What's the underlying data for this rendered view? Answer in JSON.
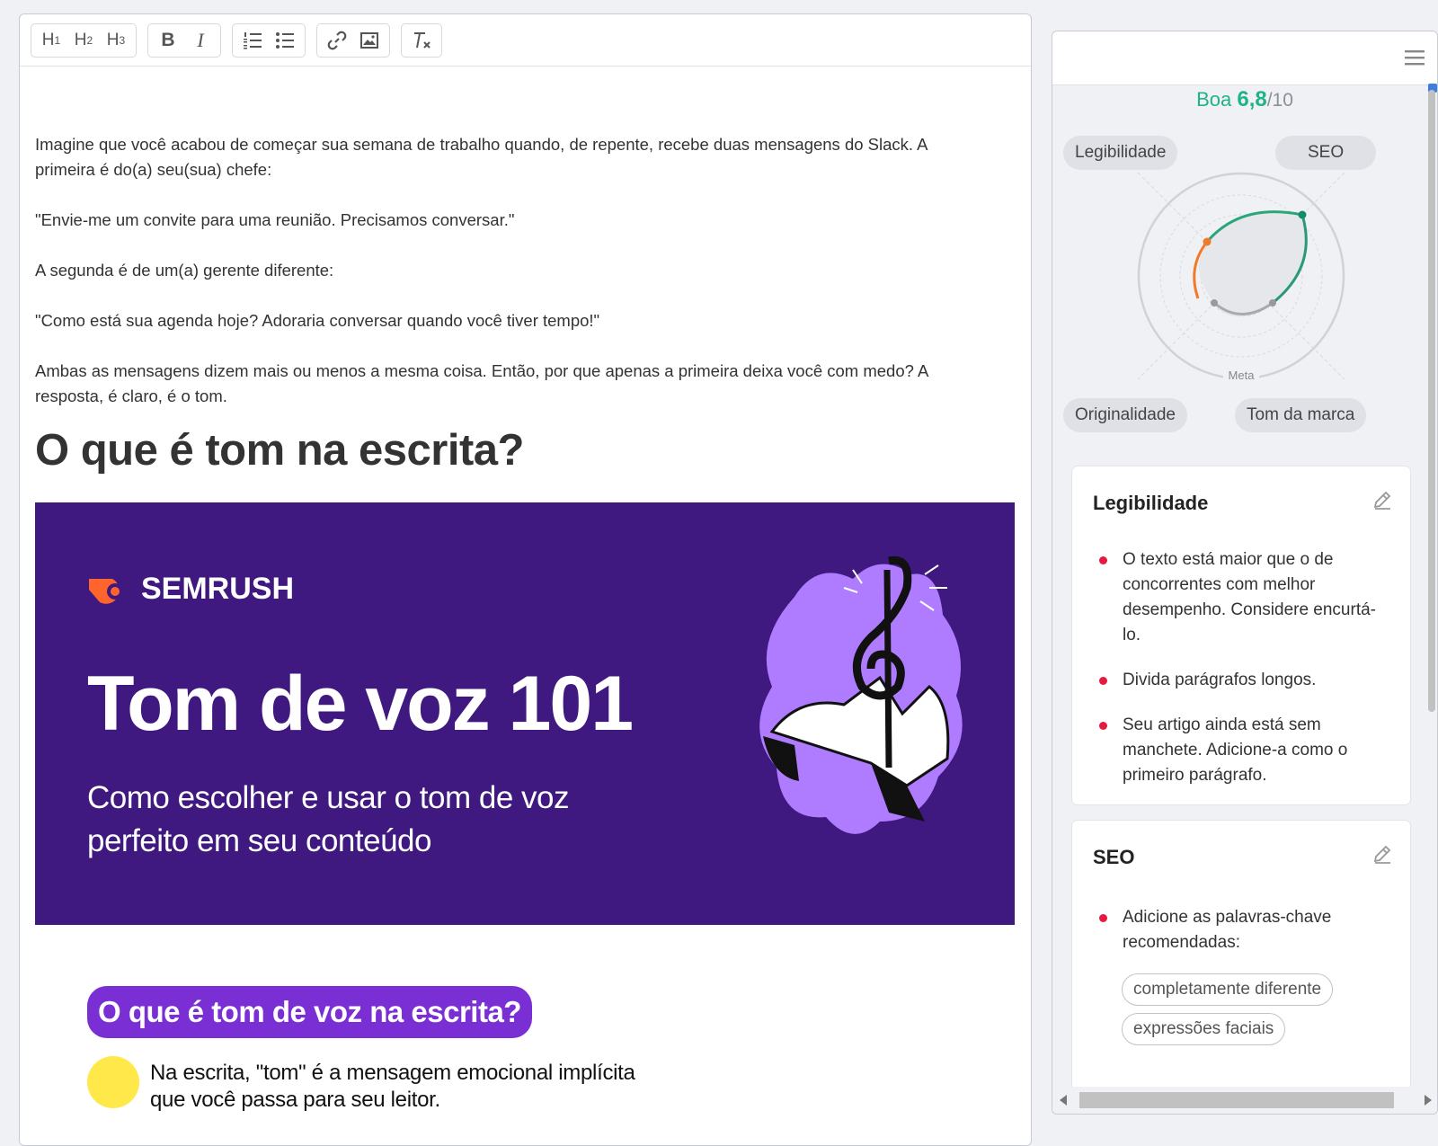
{
  "toolbar": {
    "h1": "H",
    "h1_sub": "1",
    "h2": "H",
    "h2_sub": "2",
    "h3": "H",
    "h3_sub": "3",
    "bold": "B",
    "italic": "I"
  },
  "article": {
    "paragraphs": [
      "Imagine que você acabou de começar sua semana de trabalho quando, de repente, recebe duas mensagens do Slack. A primeira é do(a) seu(sua) chefe:",
      "\"Envie-me um convite para uma reunião. Precisamos conversar.\"",
      "A segunda é de um(a) gerente diferente:",
      "\"Como está sua agenda hoje? Adoraria conversar quando você tiver tempo!\"",
      "Ambas as mensagens dizem mais ou menos a mesma coisa. Então, por que apenas a primeira deixa você com medo? A resposta, é claro, é o tom."
    ],
    "heading": "O que é tom na escrita?",
    "banner": {
      "brand": "SEMRUSH",
      "title": "Tom de voz 101",
      "subtitle": "Como escolher e usar o tom de voz perfeito em seu conteúdo",
      "bg_color": "#3f197f",
      "art_color": "#b07cff"
    },
    "pill_heading": "O que é tom de voz na escrita?",
    "tip_text": "Na escrita, \"tom\" é a mensagem emocional implícita que você passa para seu leitor."
  },
  "panel": {
    "score_label": "Boa",
    "score_value": "6,8",
    "score_den": "/10",
    "radar": {
      "tags": [
        "Legibilidade",
        "SEO",
        "Originalidade",
        "Tom da marca"
      ],
      "center_label": "Meta"
    },
    "cards": [
      {
        "title": "Legibilidade",
        "items": [
          "O texto está maior que o de concorrentes com melhor desempenho. Considere encurtá-lo.",
          "Divida parágrafos longos.",
          "Seu artigo ainda está sem manchete. Adicione-a como o primeiro parágrafo."
        ]
      },
      {
        "title": "SEO",
        "items": [
          "Adicione as palavras-chave recomendadas:"
        ],
        "keywords": [
          "completamente diferente",
          "expressões faciais"
        ]
      }
    ]
  },
  "colors": {
    "accent_green": "#1fb38a",
    "bullet_red": "#e6193f",
    "pill_purple": "#7a2fd4"
  }
}
